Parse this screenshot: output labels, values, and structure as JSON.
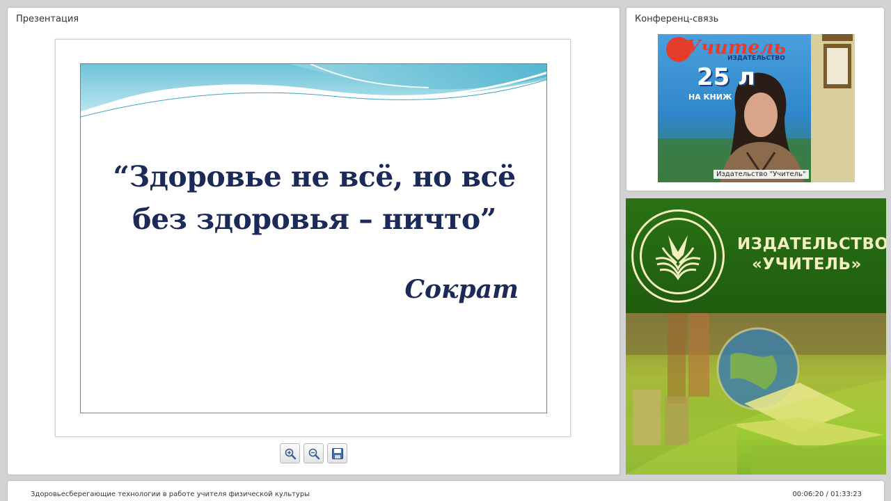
{
  "presentation_panel": {
    "title": "Презентация",
    "slide": {
      "quote_line1": "“Здоровье не всё, но всё",
      "quote_line2": "без здоровья – ничто”",
      "author": "Сократ"
    },
    "toolbar": {
      "zoom_in_icon": "zoom-in-icon",
      "zoom_out_icon": "zoom-out-icon",
      "save_icon": "floppy-disk-icon"
    }
  },
  "conference_panel": {
    "title": "Конференц-связь",
    "video": {
      "poster_word": "Учитель",
      "poster_sub": "ИЗДАТЕЛЬСТВО",
      "poster_years": "25 л",
      "poster_books": "НА КНИЖ",
      "caption": "Издательство \"Учитель\""
    }
  },
  "publisher_banner": {
    "name_line1": "ИЗДАТЕЛЬСТВО",
    "name_line2": "«УЧИТЕЛЬ»",
    "colors": {
      "green": "#1f5d10",
      "cream": "#f3efc0"
    }
  },
  "bottom_bar": {
    "lecture_title": "Здоровьесберегающие технологии в работе учителя физической культуры",
    "time": "00:06:20 / 01:33:23"
  }
}
